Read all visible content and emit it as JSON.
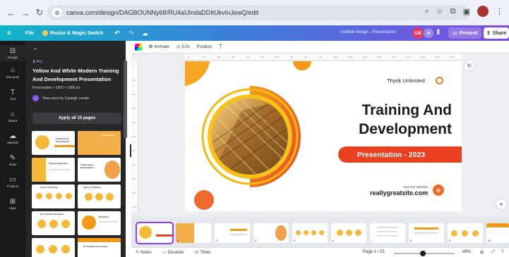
{
  "browser": {
    "url": "canva.com/design/DAGBOUNNy68/RU4aUIndaDDItUkvInJewQ/edit",
    "icons": [
      "back-arrow-icon",
      "forward-arrow-icon",
      "reload-icon",
      "tune-icon",
      "zoom-icon",
      "star-icon",
      "extensions-icon",
      "sidepanel-icon",
      "profile-avatar",
      "more-icon"
    ]
  },
  "header": {
    "menu_icon": "≡",
    "file_label": "File",
    "resize_label": "Resize & Magic Switch",
    "undo_icon": "↶",
    "redo_icon": "↷",
    "cloud_icon": "☁",
    "design_title": "Untitled design - Presentation",
    "user_initials": "UA",
    "present_label": "Present",
    "share_label": "Share"
  },
  "rail": {
    "items": [
      {
        "label": "Design",
        "icon": "⊟"
      },
      {
        "label": "Elements",
        "icon": "♧"
      },
      {
        "label": "Text",
        "icon": "T"
      },
      {
        "label": "Brand",
        "icon": "⌂"
      },
      {
        "label": "Uploads",
        "icon": "☁"
      },
      {
        "label": "Draw",
        "icon": "✎"
      },
      {
        "label": "Projects",
        "icon": "▭"
      },
      {
        "label": "Apps",
        "icon": "⊞"
      }
    ]
  },
  "panel": {
    "back_icon": "←",
    "pro_badge": "♛ Pro",
    "template_title": "Yellow And White Modern Training And Development Presentation",
    "template_meta": "Presentation • 1920 × 1080 px",
    "creator_text": "View more by Carleigh Lessie",
    "apply_label": "Apply all 15 pages"
  },
  "toolbar": {
    "animate_label": "Animate",
    "duration_label": "5.0s",
    "position_label": "Position"
  },
  "ruler": {
    "ticks": [
      "0",
      "100",
      "200",
      "300",
      "400",
      "500",
      "600",
      "700",
      "800",
      "900",
      "1000",
      "1100",
      "1200",
      "1300",
      "1400",
      "1500",
      "1600",
      "1700",
      "1800"
    ],
    "left_ticks": [
      "0",
      "100",
      "200",
      "300",
      "400",
      "500",
      "600",
      "700",
      "800",
      "900",
      "1000"
    ]
  },
  "slide": {
    "org_name": "Thynk Unlimited",
    "heading_line1": "Training And",
    "heading_line2": "Development",
    "band_text": "Presentation - 2023",
    "visit_text": "Visit Our Website",
    "website": "reallygreatsite.com"
  },
  "filmstrip": {
    "page_numbers": [
      "1",
      "2",
      "3",
      "4",
      "5",
      "6",
      "7",
      "8",
      "9",
      "10"
    ]
  },
  "status": {
    "notes_label": "Notes",
    "duration_label": "Duration",
    "timer_label": "Timer",
    "page_indicator": "Page 1 / 15",
    "zoom_level": "48%",
    "zoom_slider_fraction": 0.48
  },
  "colors": {
    "accent_orange": "#f39b19",
    "band_red": "#e94020",
    "canva_purple": "#8b3dff"
  }
}
